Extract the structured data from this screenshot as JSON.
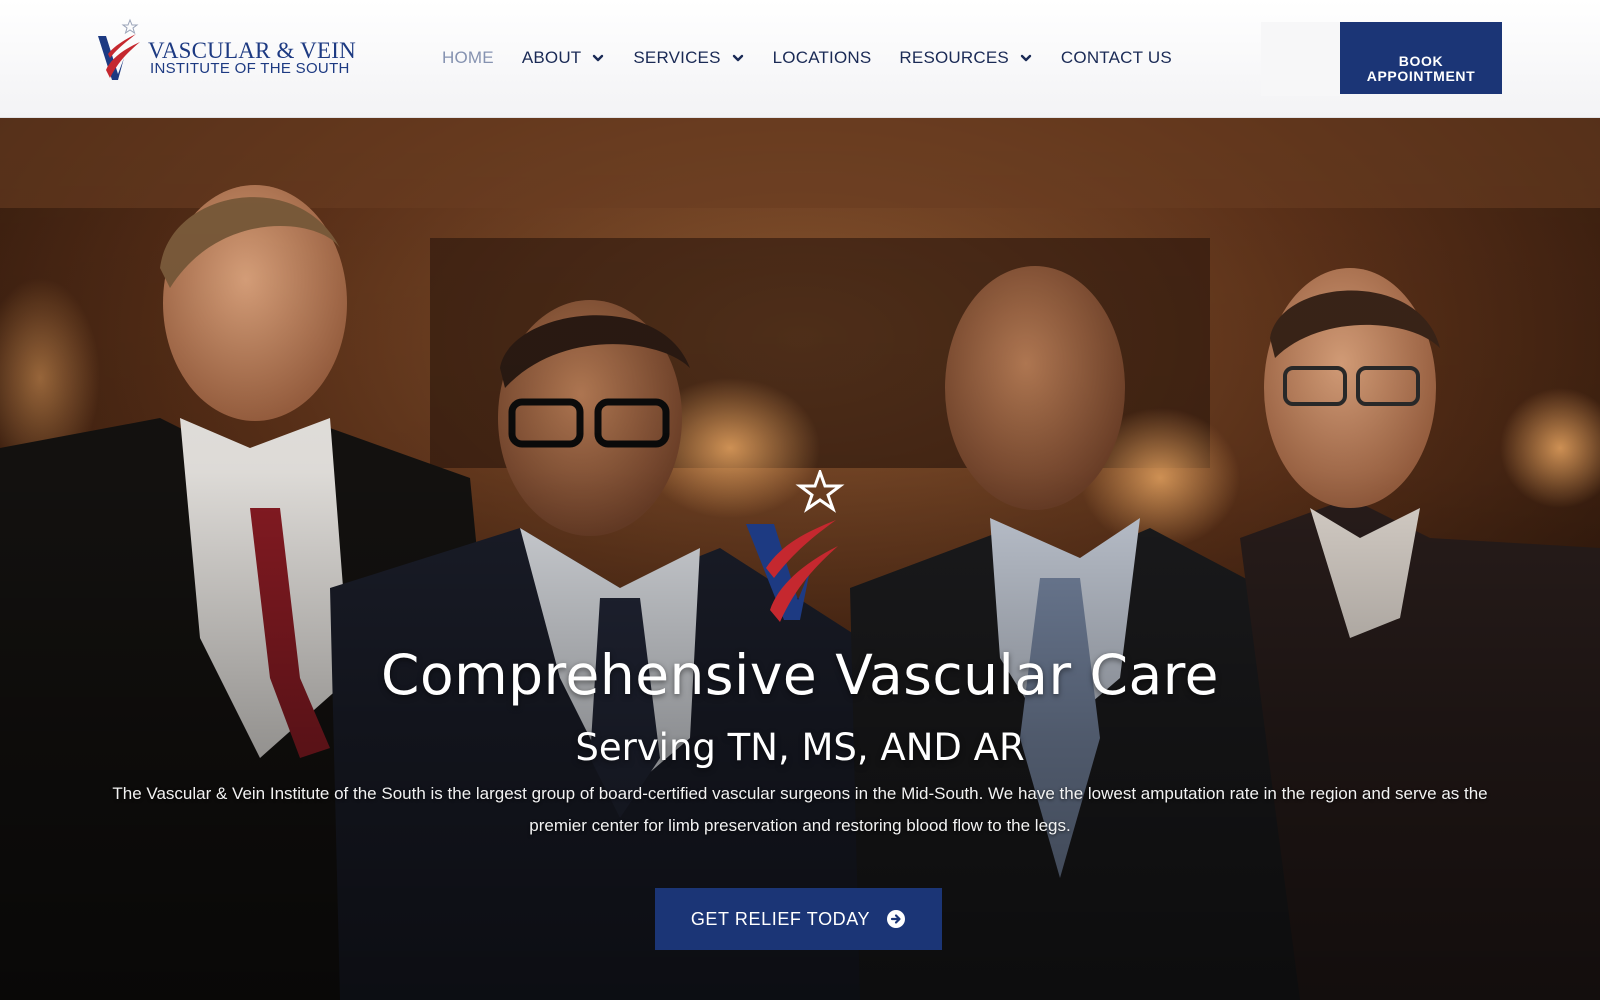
{
  "brand": {
    "line1": "VASCULAR & VEIN",
    "line2": "INSTITUTE OF THE SOUTH",
    "primary_color": "#1b3576",
    "accent_color": "#c5282f"
  },
  "nav": {
    "items": [
      {
        "label": "HOME",
        "active": true,
        "has_dropdown": false
      },
      {
        "label": "ABOUT",
        "active": false,
        "has_dropdown": true
      },
      {
        "label": "SERVICES",
        "active": false,
        "has_dropdown": true
      },
      {
        "label": "LOCATIONS",
        "active": false,
        "has_dropdown": false
      },
      {
        "label": "RESOURCES",
        "active": false,
        "has_dropdown": true
      },
      {
        "label": "CONTACT US",
        "active": false,
        "has_dropdown": false
      }
    ],
    "dropdown_icon": "chevron-down-icon"
  },
  "header": {
    "book_line1": "BOOK",
    "book_line2": "APPOINTMENT"
  },
  "hero": {
    "title": "Comprehensive Vascular Care",
    "subtitle": "Serving TN, MS, AND AR",
    "body": "The Vascular & Vein Institute of the South is the largest group of board-certified vascular surgeons in the Mid-South. We have the lowest amputation rate in the region and serve as the premier center for limb preservation and restoring blood flow to the legs.",
    "cta_label": "GET RELIEF TODAY",
    "cta_icon": "arrow-circle-right-icon"
  }
}
